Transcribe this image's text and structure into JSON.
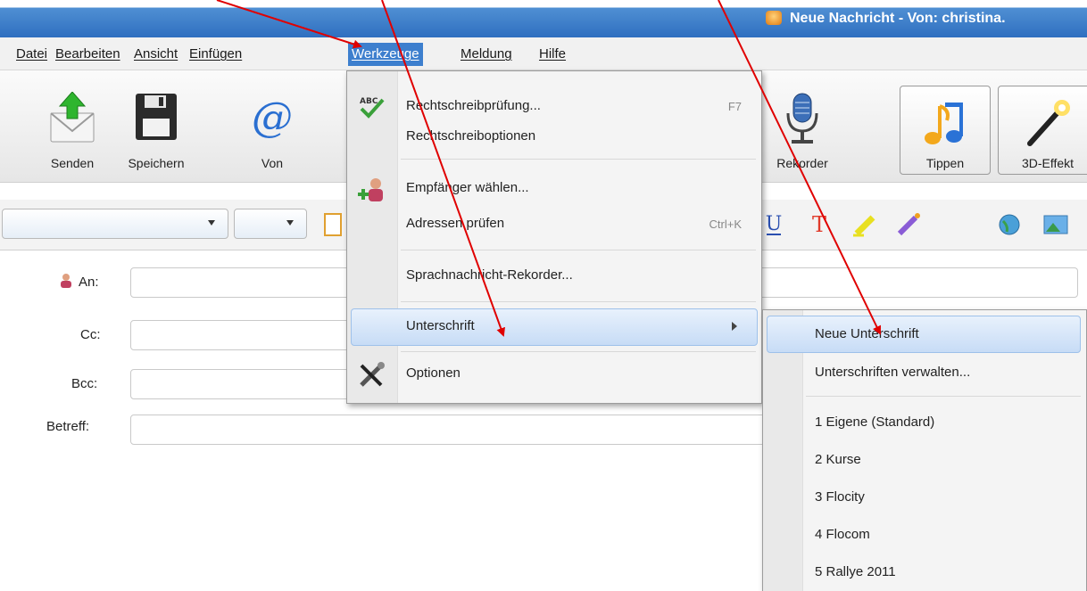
{
  "window": {
    "title": "Neue Nachricht - Von: christina."
  },
  "menubar": {
    "items": [
      "Datei",
      "Bearbeiten",
      "Ansicht",
      "Einfügen",
      "Werkzeuge",
      "Meldung",
      "Hilfe"
    ],
    "active": "Werkzeuge"
  },
  "toolbar": {
    "send": "Senden",
    "save": "Speichern",
    "from": "Von",
    "recorder": "Rekorder",
    "tips": "Tippen",
    "effects": "3D-Effekt"
  },
  "fields": {
    "to": "An:",
    "cc": "Cc:",
    "bcc": "Bcc:",
    "subject": "Betreff:"
  },
  "tools_menu": {
    "spellcheck": {
      "label": "Rechtschreibprüfung...",
      "shortcut": "F7",
      "icon": "abc-check-icon"
    },
    "spell_options": {
      "label": "Rechtschreiboptionen"
    },
    "select_recipients": {
      "label": "Empfänger wählen...",
      "icon": "person-add-icon"
    },
    "check_addresses": {
      "label": "Adressen prüfen",
      "shortcut": "Ctrl+K"
    },
    "voice_recorder": {
      "label": "Sprachnachricht-Rekorder..."
    },
    "signature": {
      "label": "Unterschrift"
    },
    "options": {
      "label": "Optionen",
      "icon": "tools-icon"
    }
  },
  "signature_menu": {
    "new": "Neue Unterschrift",
    "manage": "Unterschriften verwalten...",
    "items": [
      "1 Eigene (Standard)",
      "2 Kurse",
      "3 Flocity",
      "4 Flocom",
      "5 Rallye 2011"
    ]
  },
  "colors": {
    "titlebar": "#2f6fc0",
    "menu_highlight": "#3d7fce",
    "annotation_arrow": "#e00000"
  }
}
